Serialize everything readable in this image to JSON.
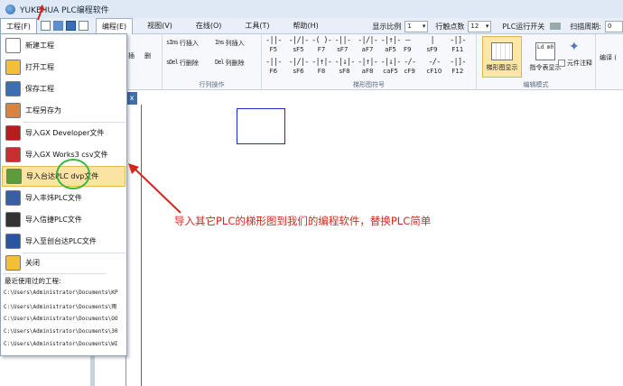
{
  "app": {
    "title": "YUKEHUA PLC编程软件"
  },
  "menubar": {
    "items": [
      "工程(F)",
      "编程(E)",
      "视图(V)",
      "在线(O)",
      "工具(T)",
      "帮助(H)"
    ],
    "display_ratio_label": "显示比例",
    "display_ratio_value": "1",
    "row_points_label": "行触点数",
    "row_points_value": "12",
    "plc_switch_label": "PLC运行开关",
    "scan_period_label": "扫描周期:",
    "scan_period_value": "0"
  },
  "ribbon": {
    "partial_labels": [
      "插",
      "删"
    ],
    "row_ops": {
      "insert_row": "行插入",
      "insert_row_key": "sIns",
      "insert_col": "列插入",
      "insert_col_key": "Ins",
      "delete_row": "行删除",
      "delete_row_key": "sDel",
      "delete_col": "列删除",
      "delete_col_key": "Del",
      "group_label": "行列操作"
    },
    "symbols": {
      "row1": [
        {
          "glyph": "-||-",
          "key": "F5"
        },
        {
          "glyph": "-|/|-",
          "key": "sF5"
        },
        {
          "glyph": "-( )-",
          "key": "F7"
        },
        {
          "glyph": "-||-",
          "key": "sF7"
        },
        {
          "glyph": "-|/|-",
          "key": "aF7"
        },
        {
          "glyph": "-|↑|-",
          "key": "aF5"
        },
        {
          "glyph": "—",
          "key": "F9"
        },
        {
          "glyph": "|",
          "key": "sF9"
        },
        {
          "glyph": "-|]-",
          "key": "F11"
        }
      ],
      "row2": [
        {
          "glyph": "-||-",
          "key": "F6"
        },
        {
          "glyph": "-|/|-",
          "key": "sF6"
        },
        {
          "glyph": "-|↑|-",
          "key": "F8"
        },
        {
          "glyph": "-|↓|-",
          "key": "sF8"
        },
        {
          "glyph": "-|↑|-",
          "key": "aF8"
        },
        {
          "glyph": "-|↓|-",
          "key": "caF5"
        },
        {
          "glyph": "-/-",
          "key": "cF9"
        },
        {
          "glyph": "-/-",
          "key": "cF10"
        },
        {
          "glyph": "-|]-",
          "key": "F12"
        }
      ],
      "group_label": "梯形图符号"
    },
    "edit_mode": {
      "ladder_display": "梯形图显示",
      "instruction_display": "指令表显示",
      "instruction_icon_text": "Ld m0",
      "element_comment": "元件注释",
      "group_label": "编辑模式"
    },
    "partial_right": "编译 ("
  },
  "doc_tab": {
    "label": "x"
  },
  "file_menu": {
    "items": [
      {
        "label": "新建工程",
        "icon": "new-file-icon",
        "color": "#ffffff"
      },
      {
        "label": "打开工程",
        "icon": "open-folder-icon",
        "color": "#f2c037"
      },
      {
        "label": "保存工程",
        "icon": "save-disk-icon",
        "color": "#3a6fb5"
      },
      {
        "label": "工程另存为",
        "icon": "save-as-users-icon",
        "color": "#d9833c"
      },
      {
        "label": "导入GX Developer文件",
        "icon": "gx-developer-icon",
        "color": "#b81d1d"
      },
      {
        "label": "导入GX Works3 csv文件",
        "icon": "gx-works3-icon",
        "color": "#c83030"
      },
      {
        "label": "导入台达PLC dvp文件",
        "icon": "delta-plc-icon",
        "color": "#5a9d3a"
      },
      {
        "label": "导入丰炜PLC文件",
        "icon": "fengwei-plc-icon",
        "color": "#3a5fa0"
      },
      {
        "label": "导入信捷PLC文件",
        "icon": "xinje-plc-icon",
        "color": "#333333"
      },
      {
        "label": "导入至创台达PLC文件",
        "icon": "zhichuang-plc-icon",
        "color": "#2a55a0"
      },
      {
        "label": "关闭",
        "icon": "close-folder-icon",
        "color": "#f2c037"
      }
    ],
    "recent_title": "最近使用过的工程:",
    "recent": [
      "C:\\Users\\Administrator\\Documents\\KP",
      "C:\\Users\\Administrator\\Documents\\雨",
      "C:\\Users\\Administrator\\Documents\\OO",
      "C:\\Users\\Administrator\\Documents\\30",
      "C:\\Users\\Administrator\\Documents\\WI"
    ]
  },
  "annotation": {
    "text": "导入其它PLC的梯形图到我们的编程软件，替换PLC简单",
    "color": "#d3271e"
  }
}
